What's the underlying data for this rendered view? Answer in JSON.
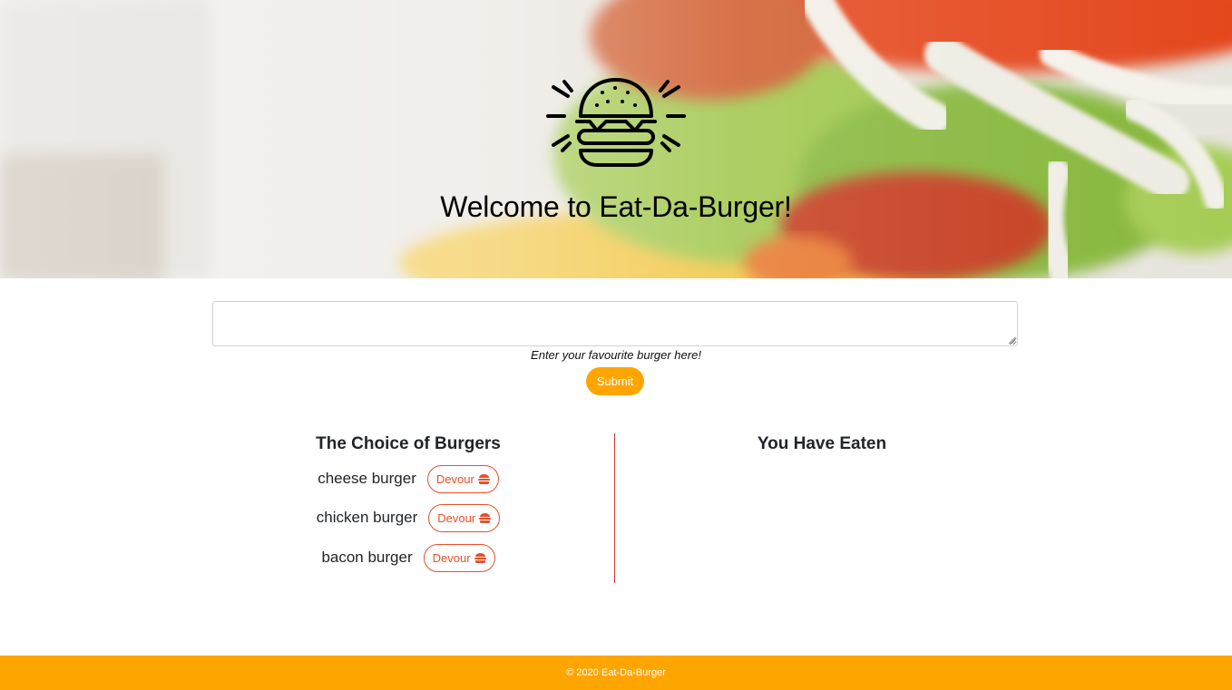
{
  "hero": {
    "title": "Welcome to Eat-Da-Burger!",
    "logo_icon": "burger-logo-icon"
  },
  "form": {
    "textarea_value": "",
    "helper_text": "Enter your favourite burger here!",
    "submit_label": "Submit"
  },
  "left_column": {
    "heading": "The Choice of Burgers",
    "burgers": [
      {
        "name": "cheese burger",
        "button_label": "Devour",
        "icon": "burger-icon"
      },
      {
        "name": "chicken burger",
        "button_label": "Devour",
        "icon": "burger-icon"
      },
      {
        "name": "bacon burger",
        "button_label": "Devour",
        "icon": "burger-icon"
      }
    ]
  },
  "right_column": {
    "heading": "You Have Eaten",
    "eaten": []
  },
  "footer": {
    "text": "© 2020 Eat-Da-Burger"
  },
  "colors": {
    "accent_orange": "#ffa500",
    "devour_red": "#e8502a",
    "divider_red": "#d9342b"
  }
}
